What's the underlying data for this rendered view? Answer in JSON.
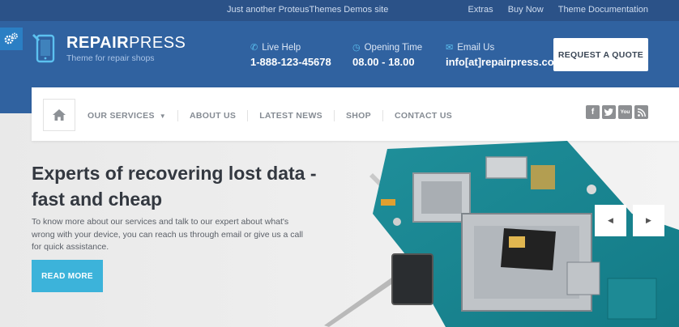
{
  "topbar": {
    "tagline": "Just another ProteusThemes Demos site",
    "links": [
      "Extras",
      "Buy Now",
      "Theme Documentation"
    ]
  },
  "logo": {
    "name_bold": "REPAIR",
    "name_light": "PRESS",
    "tagline": "Theme for repair shops"
  },
  "header_info": {
    "live_help_label": "Live Help",
    "live_help_value": "1-888-123-45678",
    "opening_label": "Opening Time",
    "opening_value": "08.00 - 18.00",
    "email_label": "Email Us",
    "email_value": "info[at]repairpress.com"
  },
  "quote_button": "REQUEST A QUOTE",
  "nav": {
    "items": [
      "OUR SERVICES",
      "ABOUT US",
      "LATEST NEWS",
      "SHOP",
      "CONTACT US"
    ]
  },
  "social_icons": [
    "facebook-icon",
    "twitter-icon",
    "youtube-icon",
    "rss-icon"
  ],
  "hero": {
    "headline": "Experts of recovering lost data - fast and cheap",
    "description": "To know more about our services and talk to our expert about what's wrong with your device, you can reach us through email or give us a call for quick assistance.",
    "button": "READ MORE"
  },
  "colors": {
    "topbar": "#2b5288",
    "header": "#3062a0",
    "accent": "#3cb3da"
  }
}
